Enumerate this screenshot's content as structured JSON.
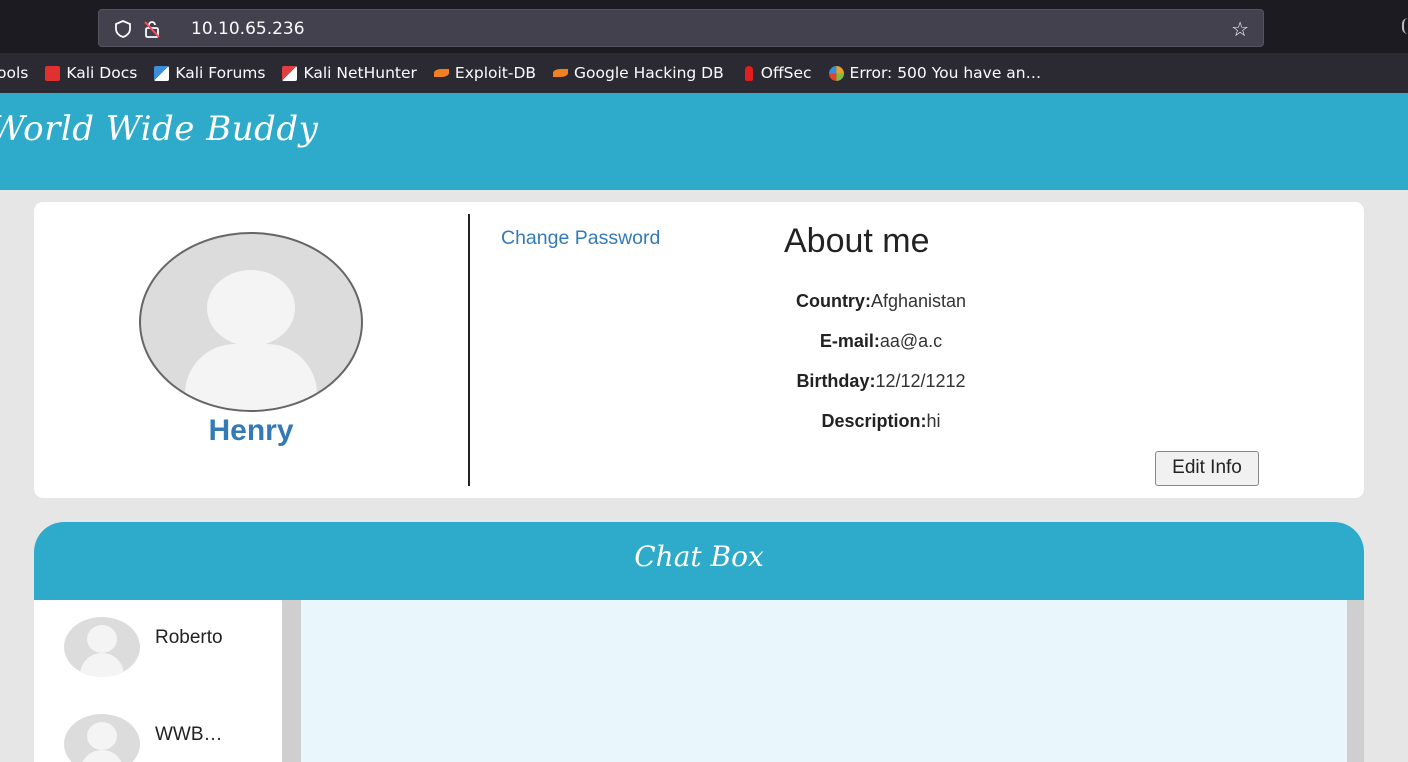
{
  "browser": {
    "url": "10.10.65.236",
    "bookmarks": [
      {
        "label": "ools",
        "icon": "",
        "color": ""
      },
      {
        "label": "Kali Docs",
        "icon": "kali-docs-icon",
        "color": "#e03030"
      },
      {
        "label": "Kali Forums",
        "icon": "kali-forums-icon",
        "color": "#3a8fd8"
      },
      {
        "label": "Kali NetHunter",
        "icon": "kali-nethunter-icon",
        "color": "#e04040"
      },
      {
        "label": "Exploit-DB",
        "icon": "exploit-db-icon",
        "color": "#f08020"
      },
      {
        "label": "Google Hacking DB",
        "icon": "ghdb-icon",
        "color": "#f08020"
      },
      {
        "label": "OffSec",
        "icon": "offsec-icon",
        "color": "#e02020"
      },
      {
        "label": "Error: 500 You have an…",
        "icon": "joomla-icon",
        "color": "#f0a020"
      }
    ]
  },
  "site": {
    "title": "World Wide Buddy",
    "accent": "#2eabcb"
  },
  "profile": {
    "name": "Henry",
    "change_password": "Change Password",
    "about_title": "About me",
    "fields": [
      {
        "label": "Country:",
        "value": "Afghanistan"
      },
      {
        "label": "E-mail:",
        "value": "aa@a.c"
      },
      {
        "label": "Birthday:",
        "value": "12/12/1212"
      },
      {
        "label": "Description:",
        "value": "hi"
      }
    ],
    "edit_button": "Edit Info"
  },
  "chat": {
    "title": "Chat Box",
    "contacts": [
      {
        "name": "Roberto"
      },
      {
        "name": "WWB…"
      }
    ]
  }
}
